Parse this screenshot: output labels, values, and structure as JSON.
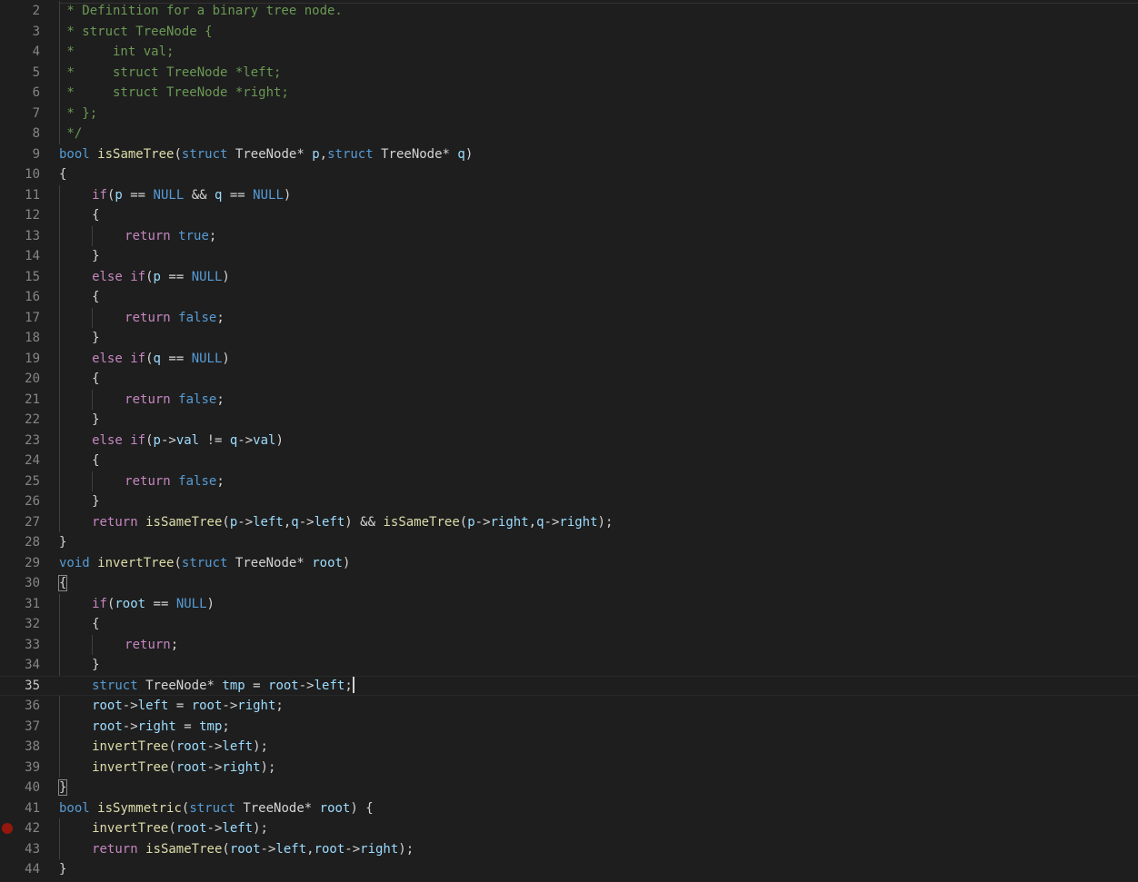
{
  "editor": {
    "language": "c",
    "current_line": 35,
    "breakpoint_lines": [
      42
    ],
    "bracket_match_lines": [
      30,
      40
    ],
    "colors": {
      "background": "#1e1e1e",
      "comment": "#6a9955",
      "keyword": "#569cd6",
      "control": "#c586c0",
      "function": "#dcdcaa",
      "variable": "#9cdcfe",
      "text": "#d4d4d4",
      "line_number": "#858585",
      "breakpoint": "#e51400"
    },
    "lines": [
      {
        "n": "2",
        "indent": 0,
        "tokens": [
          [
            "cm",
            " * Definition for a binary tree node."
          ]
        ]
      },
      {
        "n": "3",
        "indent": 0,
        "tokens": [
          [
            "cm",
            " * struct TreeNode {"
          ]
        ]
      },
      {
        "n": "4",
        "indent": 0,
        "tokens": [
          [
            "cm",
            " *     int val;"
          ]
        ]
      },
      {
        "n": "5",
        "indent": 0,
        "tokens": [
          [
            "cm",
            " *     struct TreeNode *left;"
          ]
        ]
      },
      {
        "n": "6",
        "indent": 0,
        "tokens": [
          [
            "cm",
            " *     struct TreeNode *right;"
          ]
        ]
      },
      {
        "n": "7",
        "indent": 0,
        "tokens": [
          [
            "cm",
            " * };"
          ]
        ]
      },
      {
        "n": "8",
        "indent": 0,
        "tokens": [
          [
            "cm",
            " */"
          ]
        ]
      },
      {
        "n": "9",
        "indent": 0,
        "tokens": [
          [
            "kw",
            "bool"
          ],
          [
            "txt",
            " "
          ],
          [
            "fn",
            "isSameTree"
          ],
          [
            "pun",
            "("
          ],
          [
            "kw",
            "struct"
          ],
          [
            "txt",
            " "
          ],
          [
            "ty",
            "TreeNode"
          ],
          [
            "op",
            "*"
          ],
          [
            "txt",
            " "
          ],
          [
            "var",
            "p"
          ],
          [
            "pun",
            ","
          ],
          [
            "kw",
            "struct"
          ],
          [
            "txt",
            " "
          ],
          [
            "ty",
            "TreeNode"
          ],
          [
            "op",
            "*"
          ],
          [
            "txt",
            " "
          ],
          [
            "var",
            "q"
          ],
          [
            "pun",
            ")"
          ]
        ]
      },
      {
        "n": "10",
        "indent": 0,
        "tokens": [
          [
            "pun",
            "{"
          ]
        ]
      },
      {
        "n": "11",
        "indent": 1,
        "tokens": [
          [
            "ctl",
            "if"
          ],
          [
            "pun",
            "("
          ],
          [
            "var",
            "p"
          ],
          [
            "txt",
            " "
          ],
          [
            "op",
            "=="
          ],
          [
            "txt",
            " "
          ],
          [
            "kw",
            "NULL"
          ],
          [
            "txt",
            " "
          ],
          [
            "op",
            "&&"
          ],
          [
            "txt",
            " "
          ],
          [
            "var",
            "q"
          ],
          [
            "txt",
            " "
          ],
          [
            "op",
            "=="
          ],
          [
            "txt",
            " "
          ],
          [
            "kw",
            "NULL"
          ],
          [
            "pun",
            ")"
          ]
        ]
      },
      {
        "n": "12",
        "indent": 1,
        "tokens": [
          [
            "pun",
            "{"
          ]
        ]
      },
      {
        "n": "13",
        "indent": 2,
        "tokens": [
          [
            "ctl",
            "return"
          ],
          [
            "txt",
            " "
          ],
          [
            "kw",
            "true"
          ],
          [
            "pun",
            ";"
          ]
        ]
      },
      {
        "n": "14",
        "indent": 1,
        "tokens": [
          [
            "pun",
            "}"
          ]
        ]
      },
      {
        "n": "15",
        "indent": 1,
        "tokens": [
          [
            "ctl",
            "else"
          ],
          [
            "txt",
            " "
          ],
          [
            "ctl",
            "if"
          ],
          [
            "pun",
            "("
          ],
          [
            "var",
            "p"
          ],
          [
            "txt",
            " "
          ],
          [
            "op",
            "=="
          ],
          [
            "txt",
            " "
          ],
          [
            "kw",
            "NULL"
          ],
          [
            "pun",
            ")"
          ]
        ]
      },
      {
        "n": "16",
        "indent": 1,
        "tokens": [
          [
            "pun",
            "{"
          ]
        ]
      },
      {
        "n": "17",
        "indent": 2,
        "tokens": [
          [
            "ctl",
            "return"
          ],
          [
            "txt",
            " "
          ],
          [
            "kw",
            "false"
          ],
          [
            "pun",
            ";"
          ]
        ]
      },
      {
        "n": "18",
        "indent": 1,
        "tokens": [
          [
            "pun",
            "}"
          ]
        ]
      },
      {
        "n": "19",
        "indent": 1,
        "tokens": [
          [
            "ctl",
            "else"
          ],
          [
            "txt",
            " "
          ],
          [
            "ctl",
            "if"
          ],
          [
            "pun",
            "("
          ],
          [
            "var",
            "q"
          ],
          [
            "txt",
            " "
          ],
          [
            "op",
            "=="
          ],
          [
            "txt",
            " "
          ],
          [
            "kw",
            "NULL"
          ],
          [
            "pun",
            ")"
          ]
        ]
      },
      {
        "n": "20",
        "indent": 1,
        "tokens": [
          [
            "pun",
            "{"
          ]
        ]
      },
      {
        "n": "21",
        "indent": 2,
        "tokens": [
          [
            "ctl",
            "return"
          ],
          [
            "txt",
            " "
          ],
          [
            "kw",
            "false"
          ],
          [
            "pun",
            ";"
          ]
        ]
      },
      {
        "n": "22",
        "indent": 1,
        "tokens": [
          [
            "pun",
            "}"
          ]
        ]
      },
      {
        "n": "23",
        "indent": 1,
        "tokens": [
          [
            "ctl",
            "else"
          ],
          [
            "txt",
            " "
          ],
          [
            "ctl",
            "if"
          ],
          [
            "pun",
            "("
          ],
          [
            "var",
            "p"
          ],
          [
            "op",
            "->"
          ],
          [
            "var",
            "val"
          ],
          [
            "txt",
            " "
          ],
          [
            "op",
            "!="
          ],
          [
            "txt",
            " "
          ],
          [
            "var",
            "q"
          ],
          [
            "op",
            "->"
          ],
          [
            "var",
            "val"
          ],
          [
            "pun",
            ")"
          ]
        ]
      },
      {
        "n": "24",
        "indent": 1,
        "tokens": [
          [
            "pun",
            "{"
          ]
        ]
      },
      {
        "n": "25",
        "indent": 2,
        "tokens": [
          [
            "ctl",
            "return"
          ],
          [
            "txt",
            " "
          ],
          [
            "kw",
            "false"
          ],
          [
            "pun",
            ";"
          ]
        ]
      },
      {
        "n": "26",
        "indent": 1,
        "tokens": [
          [
            "pun",
            "}"
          ]
        ]
      },
      {
        "n": "27",
        "indent": 1,
        "tokens": [
          [
            "ctl",
            "return"
          ],
          [
            "txt",
            " "
          ],
          [
            "fn",
            "isSameTree"
          ],
          [
            "pun",
            "("
          ],
          [
            "var",
            "p"
          ],
          [
            "op",
            "->"
          ],
          [
            "var",
            "left"
          ],
          [
            "pun",
            ","
          ],
          [
            "var",
            "q"
          ],
          [
            "op",
            "->"
          ],
          [
            "var",
            "left"
          ],
          [
            "pun",
            ")"
          ],
          [
            "txt",
            " "
          ],
          [
            "op",
            "&&"
          ],
          [
            "txt",
            " "
          ],
          [
            "fn",
            "isSameTree"
          ],
          [
            "pun",
            "("
          ],
          [
            "var",
            "p"
          ],
          [
            "op",
            "->"
          ],
          [
            "var",
            "right"
          ],
          [
            "pun",
            ","
          ],
          [
            "var",
            "q"
          ],
          [
            "op",
            "->"
          ],
          [
            "var",
            "right"
          ],
          [
            "pun",
            ");"
          ]
        ]
      },
      {
        "n": "28",
        "indent": 0,
        "tokens": [
          [
            "pun",
            "}"
          ]
        ]
      },
      {
        "n": "29",
        "indent": 0,
        "tokens": [
          [
            "kw",
            "void"
          ],
          [
            "txt",
            " "
          ],
          [
            "fn",
            "invertTree"
          ],
          [
            "pun",
            "("
          ],
          [
            "kw",
            "struct"
          ],
          [
            "txt",
            " "
          ],
          [
            "ty",
            "TreeNode"
          ],
          [
            "op",
            "*"
          ],
          [
            "txt",
            " "
          ],
          [
            "var",
            "root"
          ],
          [
            "pun",
            ")"
          ]
        ]
      },
      {
        "n": "30",
        "indent": 0,
        "tokens": [
          [
            "pun",
            "{"
          ]
        ],
        "bracket": true
      },
      {
        "n": "31",
        "indent": 1,
        "tokens": [
          [
            "ctl",
            "if"
          ],
          [
            "pun",
            "("
          ],
          [
            "var",
            "root"
          ],
          [
            "txt",
            " "
          ],
          [
            "op",
            "=="
          ],
          [
            "txt",
            " "
          ],
          [
            "kw",
            "NULL"
          ],
          [
            "pun",
            ")"
          ]
        ]
      },
      {
        "n": "32",
        "indent": 1,
        "tokens": [
          [
            "pun",
            "{"
          ]
        ]
      },
      {
        "n": "33",
        "indent": 2,
        "tokens": [
          [
            "ctl",
            "return"
          ],
          [
            "pun",
            ";"
          ]
        ]
      },
      {
        "n": "34",
        "indent": 1,
        "tokens": [
          [
            "pun",
            "}"
          ]
        ]
      },
      {
        "n": "35",
        "indent": 1,
        "tokens": [
          [
            "kw",
            "struct"
          ],
          [
            "txt",
            " "
          ],
          [
            "ty",
            "TreeNode"
          ],
          [
            "op",
            "*"
          ],
          [
            "txt",
            " "
          ],
          [
            "var",
            "tmp"
          ],
          [
            "txt",
            " "
          ],
          [
            "op",
            "="
          ],
          [
            "txt",
            " "
          ],
          [
            "var",
            "root"
          ],
          [
            "op",
            "->"
          ],
          [
            "var",
            "left"
          ],
          [
            "pun",
            ";"
          ]
        ],
        "cursor": true
      },
      {
        "n": "36",
        "indent": 1,
        "tokens": [
          [
            "var",
            "root"
          ],
          [
            "op",
            "->"
          ],
          [
            "var",
            "left"
          ],
          [
            "txt",
            " "
          ],
          [
            "op",
            "="
          ],
          [
            "txt",
            " "
          ],
          [
            "var",
            "root"
          ],
          [
            "op",
            "->"
          ],
          [
            "var",
            "right"
          ],
          [
            "pun",
            ";"
          ]
        ]
      },
      {
        "n": "37",
        "indent": 1,
        "tokens": [
          [
            "var",
            "root"
          ],
          [
            "op",
            "->"
          ],
          [
            "var",
            "right"
          ],
          [
            "txt",
            " "
          ],
          [
            "op",
            "="
          ],
          [
            "txt",
            " "
          ],
          [
            "var",
            "tmp"
          ],
          [
            "pun",
            ";"
          ]
        ]
      },
      {
        "n": "38",
        "indent": 1,
        "tokens": [
          [
            "fn",
            "invertTree"
          ],
          [
            "pun",
            "("
          ],
          [
            "var",
            "root"
          ],
          [
            "op",
            "->"
          ],
          [
            "var",
            "left"
          ],
          [
            "pun",
            ");"
          ]
        ]
      },
      {
        "n": "39",
        "indent": 1,
        "tokens": [
          [
            "fn",
            "invertTree"
          ],
          [
            "pun",
            "("
          ],
          [
            "var",
            "root"
          ],
          [
            "op",
            "->"
          ],
          [
            "var",
            "right"
          ],
          [
            "pun",
            ");"
          ]
        ]
      },
      {
        "n": "40",
        "indent": 0,
        "tokens": [
          [
            "pun",
            "}"
          ]
        ],
        "bracket": true
      },
      {
        "n": "41",
        "indent": 0,
        "tokens": [
          [
            "kw",
            "bool"
          ],
          [
            "txt",
            " "
          ],
          [
            "fn",
            "isSymmetric"
          ],
          [
            "pun",
            "("
          ],
          [
            "kw",
            "struct"
          ],
          [
            "txt",
            " "
          ],
          [
            "ty",
            "TreeNode"
          ],
          [
            "op",
            "*"
          ],
          [
            "txt",
            " "
          ],
          [
            "var",
            "root"
          ],
          [
            "pun",
            ")"
          ],
          [
            "txt",
            " "
          ],
          [
            "pun",
            "{"
          ]
        ]
      },
      {
        "n": "42",
        "indent": 1,
        "tokens": [
          [
            "fn",
            "invertTree"
          ],
          [
            "pun",
            "("
          ],
          [
            "var",
            "root"
          ],
          [
            "op",
            "->"
          ],
          [
            "var",
            "left"
          ],
          [
            "pun",
            ");"
          ]
        ],
        "breakpoint": true
      },
      {
        "n": "43",
        "indent": 1,
        "tokens": [
          [
            "ctl",
            "return"
          ],
          [
            "txt",
            " "
          ],
          [
            "fn",
            "isSameTree"
          ],
          [
            "pun",
            "("
          ],
          [
            "var",
            "root"
          ],
          [
            "op",
            "->"
          ],
          [
            "var",
            "left"
          ],
          [
            "pun",
            ","
          ],
          [
            "var",
            "root"
          ],
          [
            "op",
            "->"
          ],
          [
            "var",
            "right"
          ],
          [
            "pun",
            ");"
          ]
        ]
      },
      {
        "n": "44",
        "indent": 0,
        "tokens": [
          [
            "pun",
            "}"
          ]
        ]
      }
    ]
  }
}
